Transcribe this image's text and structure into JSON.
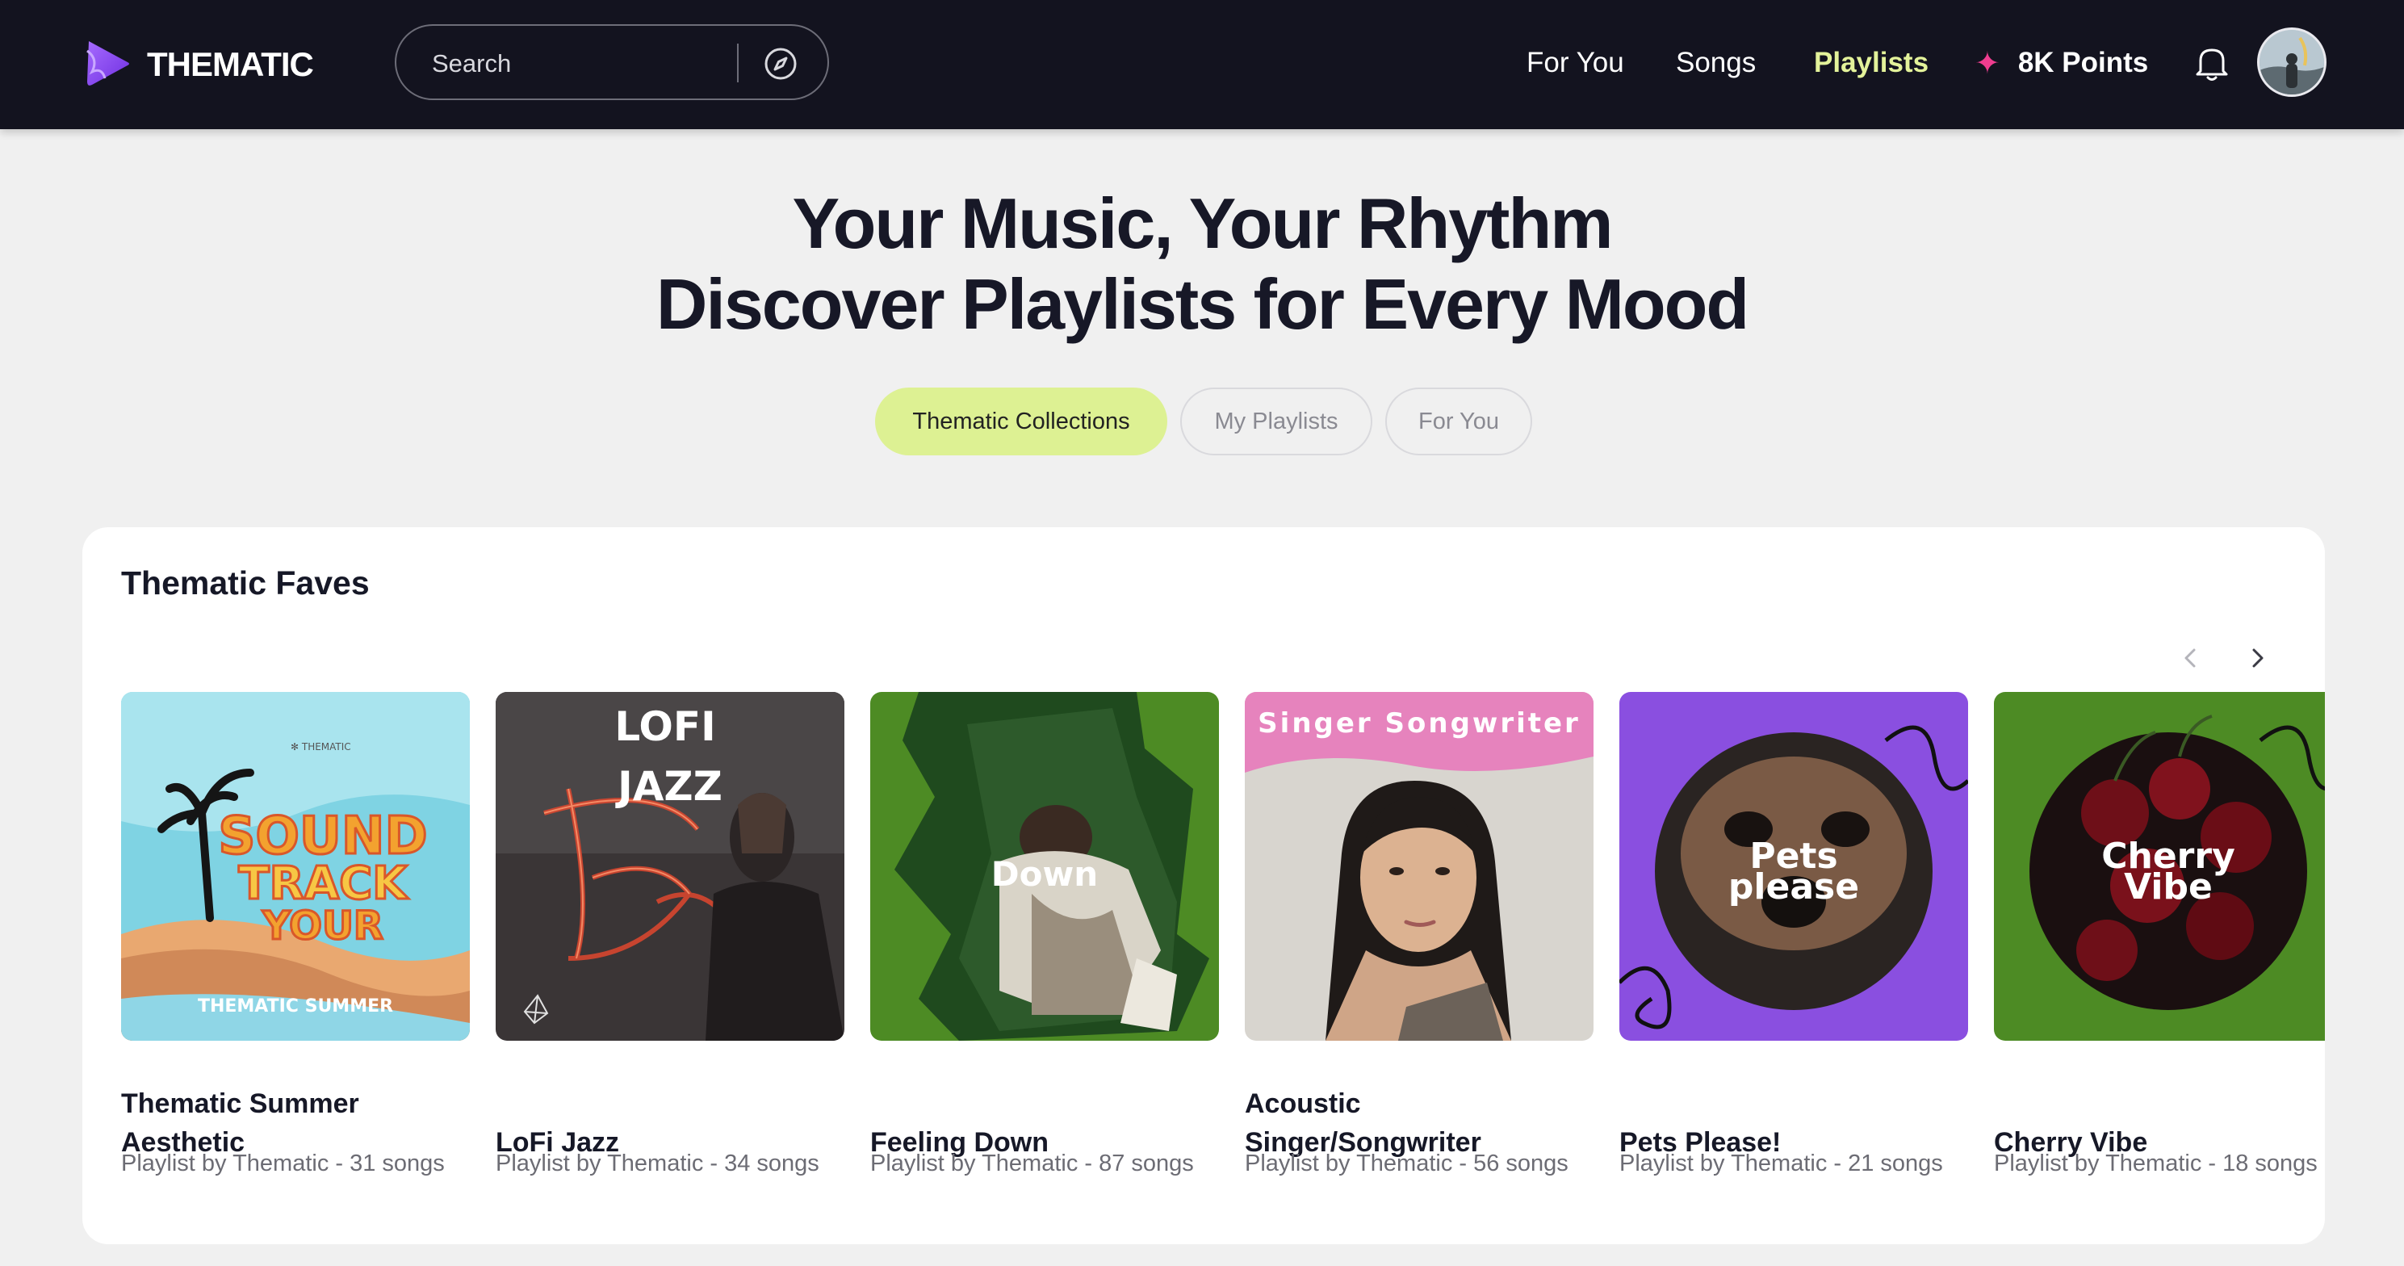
{
  "app": {
    "name": "THEMATIC"
  },
  "search": {
    "placeholder": "Search"
  },
  "nav": {
    "items": [
      "For You",
      "Songs",
      "Playlists"
    ],
    "active": "Playlists",
    "points_label": "8K Points"
  },
  "hero": {
    "line1": "Your Music, Your Rhythm",
    "line2": "Discover Playlists for Every Mood"
  },
  "tabs": [
    {
      "label": "Thematic Collections",
      "active": true
    },
    {
      "label": "My Playlists",
      "active": false
    },
    {
      "label": "For You",
      "active": false
    }
  ],
  "section": {
    "title": "Thematic Faves",
    "playlists": [
      {
        "title": "Thematic Summer Aesthetic",
        "subtitle": "Playlist by Thematic - 31 songs",
        "cover_text": "THEMATIC SUMMER",
        "cover_brand": "✻ THEMATIC"
      },
      {
        "title": "LoFi Jazz",
        "subtitle": "Playlist by Thematic - 34 songs",
        "cover_text": "LOFI JAZZ"
      },
      {
        "title": "Feeling Down",
        "subtitle": "Playlist by Thematic - 87 songs",
        "cover_text": "Down"
      },
      {
        "title": "Acoustic Singer/Songwriter",
        "subtitle": "Playlist by Thematic - 56 songs",
        "cover_text": "Singer Songwriter"
      },
      {
        "title": "Pets Please!",
        "subtitle": "Playlist by Thematic - 21 songs",
        "cover_text": "Pets please"
      },
      {
        "title": "Cherry Vibe",
        "subtitle": "Playlist by Thematic - 18 songs",
        "cover_text": "Cherry Vibe"
      }
    ]
  },
  "colors": {
    "topbar": "#13131f",
    "accent_lime": "#ddf193",
    "accent_pink": "#ef3d8f",
    "brand_purple": "#8b4cf0"
  },
  "icons": [
    "thematic-logo-icon",
    "compass-icon",
    "sparkle-icon",
    "bell-icon",
    "chevron-left-icon",
    "chevron-right-icon"
  ]
}
